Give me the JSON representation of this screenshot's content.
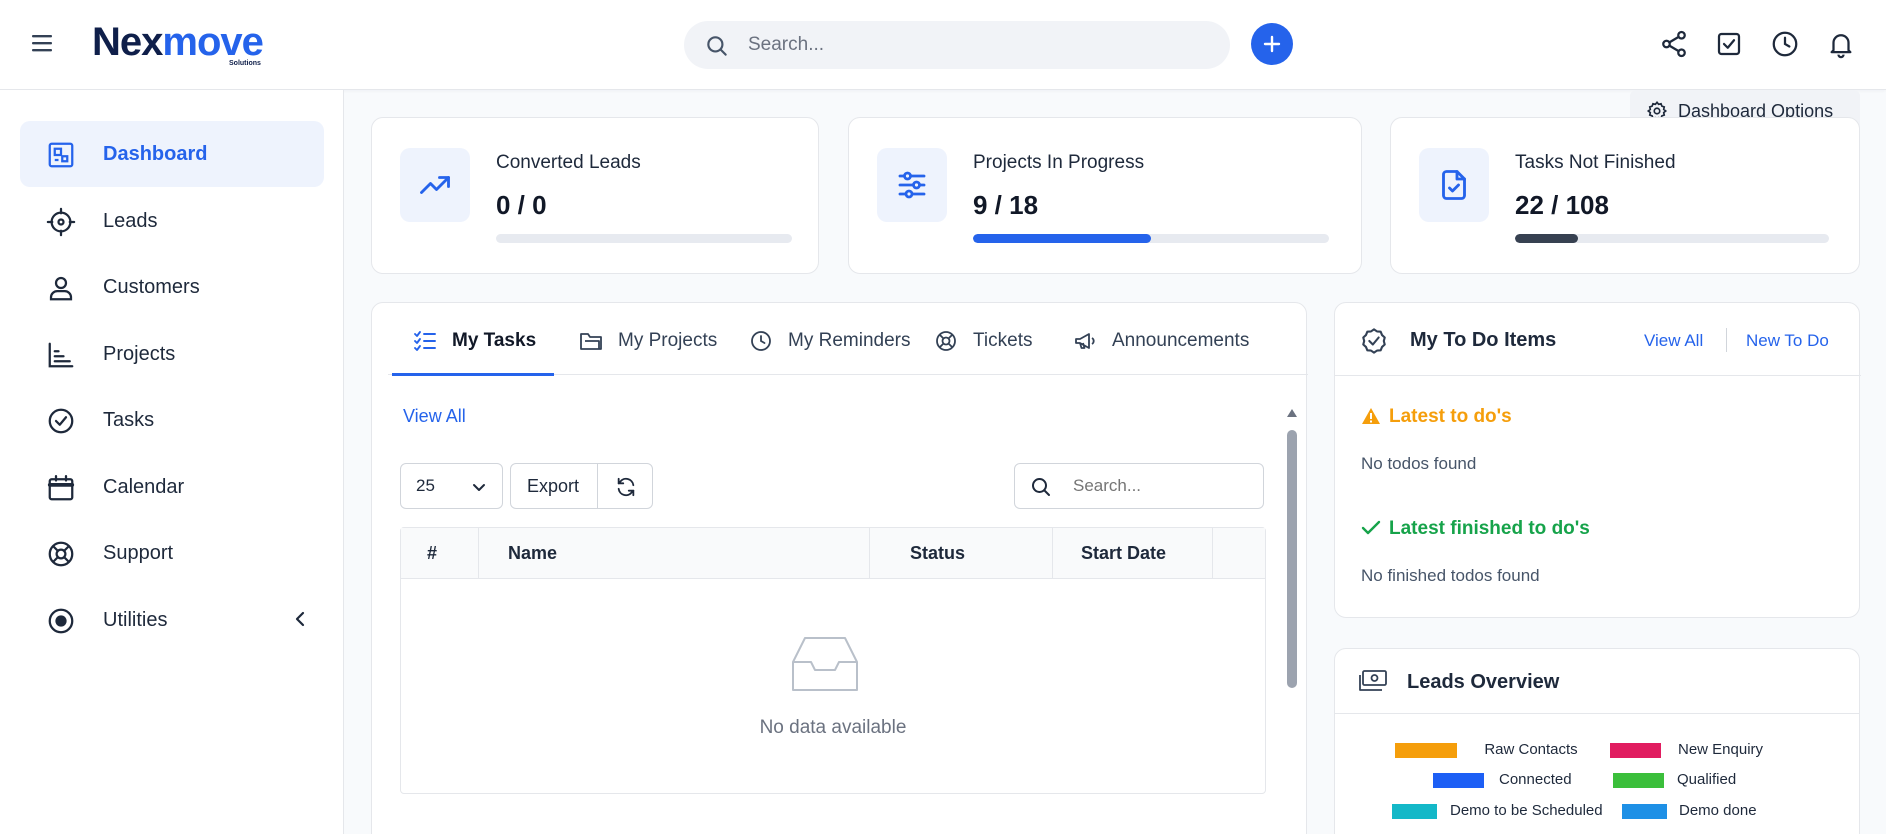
{
  "header": {
    "logo_main": "Nexmove",
    "logo_sub": "Solutions",
    "search_placeholder": "Search...",
    "icons": [
      "menu-icon",
      "search-icon",
      "plus-icon",
      "share-icon",
      "checkbox-icon",
      "clock-icon",
      "bell-icon"
    ]
  },
  "sidebar": {
    "items": [
      {
        "label": "Dashboard",
        "icon": "dashboard-icon",
        "active": true
      },
      {
        "label": "Leads",
        "icon": "crosshair-icon"
      },
      {
        "label": "Customers",
        "icon": "user-icon"
      },
      {
        "label": "Projects",
        "icon": "chart-icon"
      },
      {
        "label": "Tasks",
        "icon": "check-circle-icon"
      },
      {
        "label": "Calendar",
        "icon": "calendar-icon"
      },
      {
        "label": "Support",
        "icon": "lifebuoy-icon"
      },
      {
        "label": "Utilities",
        "icon": "radio-icon"
      }
    ]
  },
  "dashboard_options": "Dashboard Options",
  "stats": [
    {
      "title": "Converted Leads",
      "value": "0 / 0",
      "progress": 0,
      "color": "#2563eb",
      "icon": "trending-up-icon"
    },
    {
      "title": "Projects In Progress",
      "value": "9 / 18",
      "progress": 0.5,
      "color": "#2563eb",
      "icon": "sliders-icon"
    },
    {
      "title": "Tasks Not Finished",
      "value": "22 / 108",
      "progress": 0.2,
      "color": "#374151",
      "icon": "file-check-icon"
    }
  ],
  "tabs": [
    {
      "label": "My Tasks",
      "active": true,
      "icon": "list-check-icon"
    },
    {
      "label": "My Projects",
      "icon": "folder-icon"
    },
    {
      "label": "My Reminders",
      "icon": "clock-icon"
    },
    {
      "label": "Tickets",
      "icon": "lifebuoy-icon"
    },
    {
      "label": "Announcements",
      "icon": "megaphone-icon"
    }
  ],
  "tasks": {
    "view_all": "View All",
    "page_size": "25",
    "export": "Export",
    "search_placeholder": "Search...",
    "columns": [
      "#",
      "Name",
      "Status",
      "Start Date"
    ],
    "empty": "No data available"
  },
  "todo": {
    "title": "My To Do Items",
    "view_all": "View All",
    "new_todo": "New To Do",
    "latest_title": "Latest to do's",
    "latest_empty": "No todos found",
    "finished_title": "Latest finished to do's",
    "finished_empty": "No finished todos found",
    "warning_color": "#f59e0b",
    "success_color": "#16a34a"
  },
  "leads_overview": {
    "title": "Leads Overview",
    "legend": [
      {
        "label": "Raw Contacts",
        "color": "#f59e0b"
      },
      {
        "label": "New Enquiry",
        "color": "#e11d60"
      },
      {
        "label": "Connected",
        "color": "#1d5ff5"
      },
      {
        "label": "Qualified",
        "color": "#3bbf3b"
      },
      {
        "label": "Demo to be Scheduled",
        "color": "#14b8c8"
      },
      {
        "label": "Demo done",
        "color": "#1e90e6"
      }
    ]
  }
}
